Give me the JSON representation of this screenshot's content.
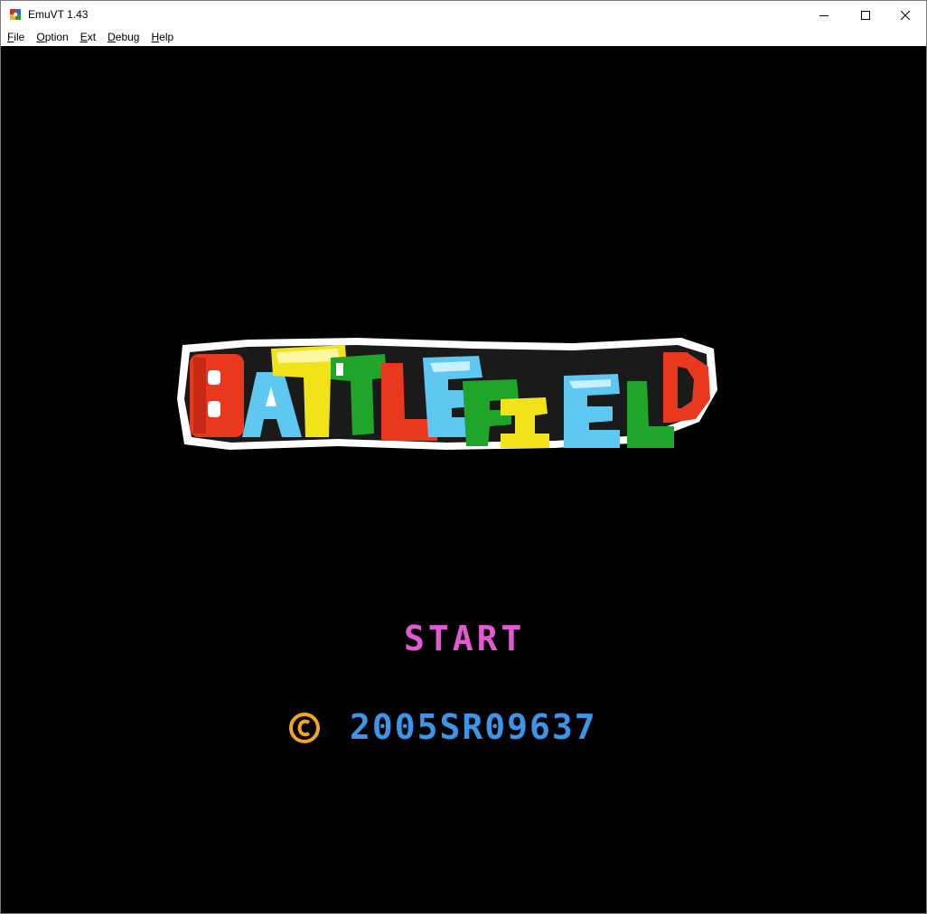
{
  "window": {
    "title": "EmuVT 1.43",
    "icon": "emuvt-app-icon"
  },
  "controls": {
    "minimize_icon": "minimize-icon",
    "maximize_icon": "maximize-icon",
    "close_icon": "close-icon"
  },
  "menu": {
    "items": [
      {
        "label": "File"
      },
      {
        "label": "Option"
      },
      {
        "label": "Ext"
      },
      {
        "label": "Debug"
      },
      {
        "label": "Help"
      }
    ]
  },
  "game": {
    "logo_text": "BATTLEFIELD",
    "start_label": "START",
    "copyright_symbol": "©",
    "serial": "2005SR09637",
    "colors": {
      "background": "#000000",
      "start": "#e35ad0",
      "serial": "#3c95e8",
      "copyright": "#f2a51e",
      "logo_red": "#e8391f",
      "logo_yellow": "#f2e21a",
      "logo_green": "#1fa52a",
      "logo_cyan": "#5ec8f2",
      "logo_outline": "#ffffff"
    }
  }
}
